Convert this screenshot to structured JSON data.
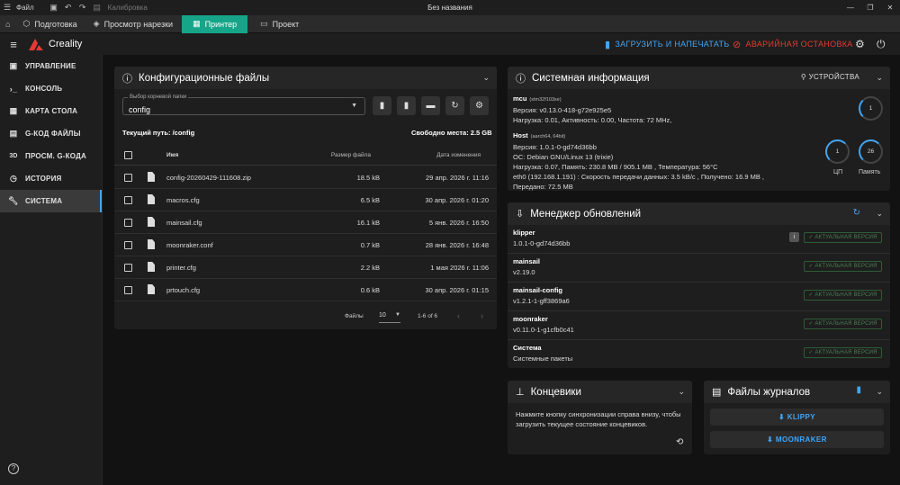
{
  "os": {
    "menu_file": "Файл",
    "calibration": "Калибровка",
    "title": "Без названия"
  },
  "tabs": [
    {
      "label": "Подготовка"
    },
    {
      "label": "Просмотр нарезки"
    },
    {
      "label": "Принтер"
    },
    {
      "label": "Проект"
    }
  ],
  "header": {
    "brand": "Creality",
    "upload_print": "ЗАГРУЗИТЬ И НАПЕЧАТАТЬ",
    "emergency_stop": "АВАРИЙНАЯ ОСТАНОВКА"
  },
  "sidebar": {
    "items": [
      {
        "label": "УПРАВЛЕНИЕ",
        "icon": "dashboard-icon"
      },
      {
        "label": "КОНСОЛЬ",
        "icon": "console-icon"
      },
      {
        "label": "КАРТА СТОЛА",
        "icon": "grid-icon"
      },
      {
        "label": "G-КОД ФАЙЛЫ",
        "icon": "file-icon"
      },
      {
        "label": "ПРОСМ. G-КОДА",
        "icon": "3d-icon"
      },
      {
        "label": "ИСТОРИЯ",
        "icon": "history-icon"
      },
      {
        "label": "СИСТЕМА",
        "icon": "wrench-icon"
      }
    ]
  },
  "config": {
    "title": "Конфигурационные файлы",
    "root_label": "Выбор корневой папки",
    "root_value": "config",
    "path_text": "Текущий путь: /config",
    "free_text": "Свободно места: 2.5 GB",
    "columns": {
      "name": "Имя",
      "size": "Размер файла",
      "date": "Дата изменения"
    },
    "files": [
      {
        "name": "config-20260429-111608.zip",
        "size": "18.5 kB",
        "date": "29 апр. 2026 г. 11:16"
      },
      {
        "name": "macros.cfg",
        "size": "6.5 kB",
        "date": "30 апр. 2026 г. 01:20"
      },
      {
        "name": "mainsail.cfg",
        "size": "16.1 kB",
        "date": "5 янв. 2026 г. 16:50"
      },
      {
        "name": "moonraker.conf",
        "size": "0.7 kB",
        "date": "28 янв. 2026 г. 16:48"
      },
      {
        "name": "printer.cfg",
        "size": "2.2 kB",
        "date": "1 мая 2026 г. 11:06"
      },
      {
        "name": "prtouch.cfg",
        "size": "0.6 kB",
        "date": "30 апр. 2026 г. 01:15"
      }
    ],
    "pager_label": "Файлы",
    "pager_size": "10",
    "pager_range": "1-6 of 6"
  },
  "sysinfo": {
    "title": "Системная информация",
    "devices": "УСТРОЙСТВА",
    "mcu": {
      "name": "mcu",
      "chip": "(stm32f103xe)",
      "version": "Версия: v0.13.0-418-g72e925e5",
      "load": "Нагрузка: 0.01, Активность: 0.00, Частота: 72 MHz,",
      "gauge": "1"
    },
    "host": {
      "name": "Host",
      "arch": "(aarch64, 64bit)",
      "version": "Версия: 1.0.1-0-gd74d36bb",
      "os": "ОС: Debian GNU/Linux 13 (trixie)",
      "load": "Нагрузка: 0.07, Память: 230.8 MB / 905.1 MB , Температура: 56°C",
      "net": "eth0 (192.168.1.191) : Скорость передачи данных: 3.5 kB/c , Получено: 16.9 MB ,",
      "sent": "Передано: 72.5 MB",
      "cpu_gauge": "1",
      "cpu_label": "ЦП",
      "mem_gauge": "26",
      "mem_label": "Память"
    }
  },
  "updates": {
    "title": "Менеджер обновлений",
    "items": [
      {
        "name": "klipper",
        "version": "1.0.1-0-gd74d36bb",
        "status": "АКТУАЛЬНАЯ ВЕРСИЯ"
      },
      {
        "name": "mainsail",
        "version": "v2.19.0",
        "status": "АКТУАЛЬНАЯ ВЕРСИЯ"
      },
      {
        "name": "mainsail-config",
        "version": "v1.2.1-1-gff3869a6",
        "status": "АКТУАЛЬНАЯ ВЕРСИЯ"
      },
      {
        "name": "moonraker",
        "version": "v0.11.0-1-g1cfb0c41",
        "status": "АКТУАЛЬНАЯ ВЕРСИЯ"
      },
      {
        "name": "Система",
        "version": "Системные пакеты",
        "status": "АКТУАЛЬНАЯ ВЕРСИЯ"
      }
    ]
  },
  "endstops": {
    "title": "Концевики",
    "text": "Нажмите кнопку синхронизации справа внизу, чтобы загрузить текущее состояние концевиков."
  },
  "logs": {
    "title": "Файлы журналов",
    "klippy": "KLIPPY",
    "moonraker": "MOONRAKER"
  },
  "colors": {
    "accent": "#42a5f5",
    "active_tab": "#17a589",
    "danger": "#e53935",
    "ok": "#4a7d52"
  }
}
